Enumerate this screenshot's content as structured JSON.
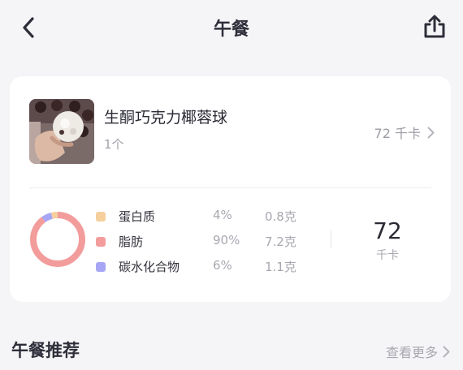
{
  "header": {
    "title": "午餐",
    "back_icon": "chevron-left-icon",
    "share_icon": "share-upload-icon"
  },
  "food": {
    "name": "生酮巧克力椰蓉球",
    "quantity": "1个",
    "calories_label": "72 千卡",
    "image": "coconut-chocolate-ball-photo"
  },
  "macros": [
    {
      "name": "蛋白质",
      "percent": "4%",
      "grams": "0.8克",
      "color": "#f6cf9d",
      "share": 0.04
    },
    {
      "name": "脂肪",
      "percent": "90%",
      "grams": "7.2克",
      "color": "#f39c9c",
      "share": 0.9
    },
    {
      "name": "碳水化合物",
      "percent": "6%",
      "grams": "1.1克",
      "color": "#a7a6f5",
      "share": 0.06
    }
  ],
  "total": {
    "value": "72",
    "unit": "千卡"
  },
  "recommend": {
    "title": "午餐推荐",
    "more": "查看更多"
  }
}
